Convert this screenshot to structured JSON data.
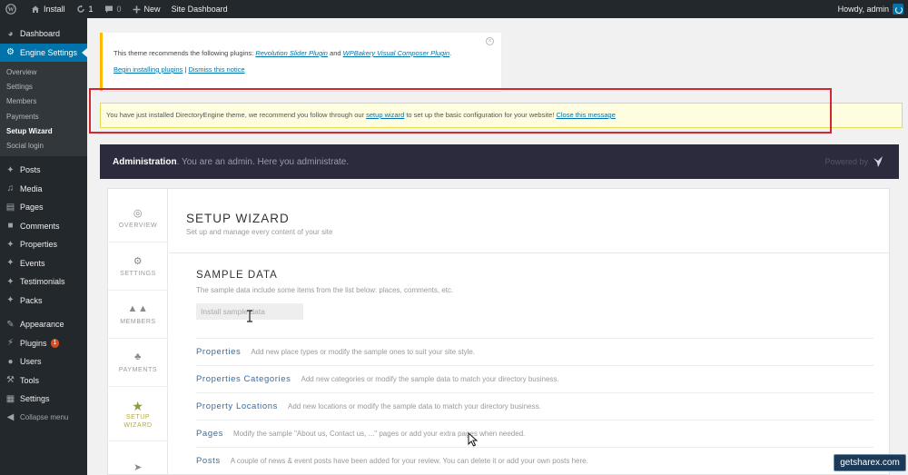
{
  "adminbar": {
    "site_name": "Install",
    "updates_count": "1",
    "comments_count": "0",
    "new_label": "New",
    "site_dashboard": "Site Dashboard",
    "howdy": "Howdy, admin"
  },
  "sidebar": {
    "dashboard": "Dashboard",
    "engine_settings": "Engine Settings",
    "submenu": [
      "Overview",
      "Settings",
      "Members",
      "Payments",
      "Setup Wizard",
      "Social login"
    ],
    "items": [
      "Posts",
      "Media",
      "Pages",
      "Comments",
      "Properties",
      "Events",
      "Testimonials",
      "Packs"
    ],
    "items2": [
      "Appearance",
      "Plugins",
      "Users",
      "Tools",
      "Settings"
    ],
    "plugins_badge": "1",
    "collapse": "Collapse menu"
  },
  "notice1": {
    "text_before": "This theme recommends the following plugins: ",
    "plugin1": "Revolution Slider Plugin",
    "text_and": " and ",
    "plugin2": "WPBakery Visual Composer Plugin",
    "text_end": ".",
    "begin_link": "Begin installing plugins",
    "separator": " | ",
    "dismiss_link": "Dismiss this notice",
    "close_glyph": "×"
  },
  "notice2": {
    "text_before": "You have just installed DirectoryEngine theme, we recommend you follow through our ",
    "wizard_link": "setup wizard",
    "text_after": " to set up the basic configuration for your website! ",
    "close_link": "Close this message"
  },
  "banner": {
    "strong": "Administration",
    "rest": ". You are an admin. Here you administrate.",
    "powered": "Powered by"
  },
  "wizard": {
    "tabs": [
      "OVERVIEW",
      "SETTINGS",
      "MEMBERS",
      "PAYMENTS",
      "SETUP",
      "WIZARD"
    ],
    "title": "SETUP WIZARD",
    "subtitle": "Set up and manage every content of your site",
    "sample_title": "SAMPLE DATA",
    "sample_desc": "The sample data include some items from the list below: places, comments, etc.",
    "install_button": "Install sample data",
    "rows": [
      {
        "label": "Properties",
        "desc": "Add new place types or modify the sample ones to suit your site style."
      },
      {
        "label": "Properties Categories",
        "desc": "Add new categories or modify the sample data to match your directory business."
      },
      {
        "label": "Property Locations",
        "desc": "Add new locations or modify the sample data to match your directory business."
      },
      {
        "label": "Pages",
        "desc": "Modify the sample \"About us, Contact us, ...\" pages or add your extra pages when needed."
      },
      {
        "label": "Posts",
        "desc": "A couple of news & event posts have been added for your review. You can delete it or add your own posts here."
      }
    ]
  },
  "watermark": "getsharex.com",
  "colors": {
    "admin_bar": "#23282d",
    "active_menu": "#0073aa",
    "banner": "#2c2b3e",
    "highlight": "#d4262c",
    "link": "#2a6fb5"
  }
}
